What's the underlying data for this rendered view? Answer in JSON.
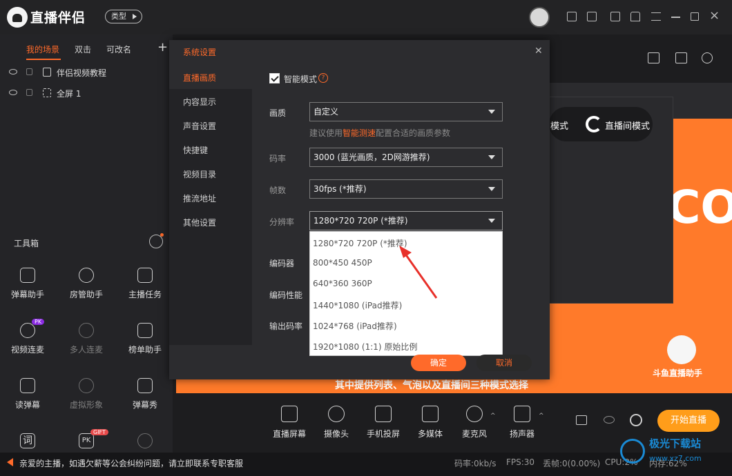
{
  "app": {
    "brand": "直播伴侣",
    "type_label": "类型"
  },
  "left": {
    "tabs": [
      "我的场景",
      "双击",
      "可改名"
    ],
    "scenes": [
      {
        "name": "伴侣视频教程"
      },
      {
        "name": "全屏 1"
      }
    ],
    "toolbox_title": "工具箱",
    "tools": [
      {
        "label": "弹幕助手"
      },
      {
        "label": "房管助手"
      },
      {
        "label": "主播任务"
      },
      {
        "label": "视频连麦",
        "badge": "PK"
      },
      {
        "label": "多人连麦"
      },
      {
        "label": "榜单助手"
      },
      {
        "label": "读弹幕"
      },
      {
        "label": "虚拟形象"
      },
      {
        "label": "弹幕秀"
      },
      {
        "label": "词"
      },
      {
        "label": "PK",
        "badge": "GIFT"
      },
      {
        "label": ""
      }
    ]
  },
  "preview": {
    "mode_text": "直播间模式",
    "mode_text_left": "模式",
    "big_text": "CO",
    "subtitle": "其中提供列表、气泡以及直播间三种模式选择",
    "douyu_label": "斗鱼直播助手"
  },
  "dialog": {
    "title": "系统设置",
    "nav": [
      "直播画质",
      "内容显示",
      "声音设置",
      "快捷键",
      "视频目录",
      "推流地址",
      "其他设置"
    ],
    "smart_mode_label": "智能模式",
    "smart_mode_checked": true,
    "quality_label": "画质",
    "quality_value": "自定义",
    "hint_pre": "建议使用",
    "hint_link": "智能测速",
    "hint_post": "配置合适的画质参数",
    "bitrate_label": "码率",
    "bitrate_value": "3000 (蓝光画质，2D网游推荐)",
    "fps_label": "帧数",
    "fps_value": "30fps (*推荐)",
    "resolution_label": "分辨率",
    "resolution_value": "1280*720 720P (*推荐)",
    "encoder_label": "编码器",
    "encoder_perf_label": "编码性能",
    "output_bitrate_label": "输出码率",
    "resolution_options": [
      "1280*720 720P (*推荐)",
      "800*450 450P",
      "640*360 360P",
      "1440*1080 (iPad推荐)",
      "1024*768 (iPad推荐)",
      "1920*1080 (1:1) 原始比例"
    ],
    "ok": "确定",
    "cancel": "取消"
  },
  "bottom": {
    "tools": [
      "直播屏幕",
      "摄像头",
      "手机投屏",
      "多媒体",
      "麦克风",
      "扬声器"
    ],
    "start": "开始直播"
  },
  "status": {
    "notice": "亲爱的主播，如遇欠薪等公会纠纷问题，请立即联系专职客服",
    "bitrate": "码率:0kb/s",
    "fps": "FPS:30",
    "dropped": "丢帧:0(0.00%)",
    "cpu": "CPU:2%",
    "mem": "内存:62%",
    "watermark": "极光下载站",
    "watermark_url": "www.xz7.com"
  },
  "colors": {
    "accent": "#ff6a2a",
    "start_button": "#ff9d1a"
  }
}
